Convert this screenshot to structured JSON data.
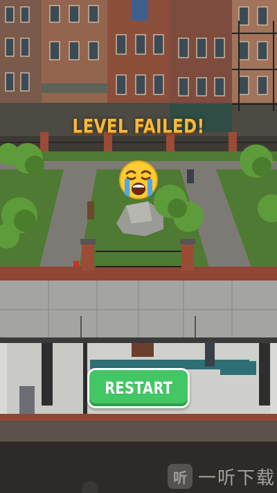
{
  "screen": {
    "status_title": "LEVEL FAILED!",
    "status_emoji": "loudly-crying-face-emoji"
  },
  "actions": {
    "restart_label": "RESTART"
  },
  "watermark": {
    "logo_text": "听",
    "text": "一听下载"
  },
  "colors": {
    "title": "#f6b93b",
    "restart_button": "#43c765",
    "grass": "#4f7a33",
    "path": "#7d7a75",
    "brick_building": "#8a4f3c",
    "train_roof": "#a4a5a2"
  }
}
